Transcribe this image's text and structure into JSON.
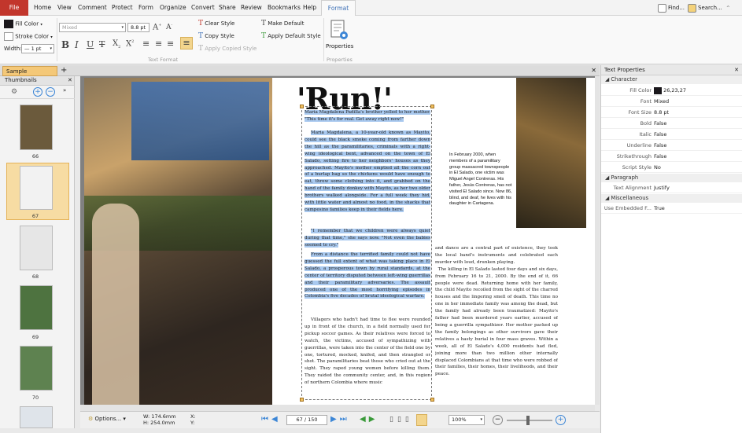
{
  "menu": {
    "file": "File",
    "items": [
      "Home",
      "View",
      "Comment",
      "Protect",
      "Form",
      "Organize",
      "Convert",
      "Share",
      "Review",
      "Bookmarks",
      "Help"
    ],
    "active": "Format",
    "find": "Find...",
    "search": "Search..."
  },
  "ribbon": {
    "fill_color": "Fill Color",
    "stroke_color": "Stroke Color",
    "width_label": "Width:",
    "width_value": "1 pt",
    "font_placeholder": "Mixed",
    "font_size": "8.8 pt",
    "clear_style": "Clear Style",
    "copy_style": "Copy Style",
    "apply_copied_style": "Apply Copied Style",
    "make_default": "Make Default",
    "apply_default_style": "Apply Default Style",
    "properties": "Properties",
    "group_text_format": "Text Format",
    "group_properties": "Properties"
  },
  "document_tab": "Sample Document *",
  "thumbnails": {
    "title": "Thumbnails",
    "pages": [
      "66",
      "67",
      "68",
      "69",
      "70"
    ]
  },
  "article": {
    "headline": "'Run!'",
    "col1_p1": "Maria Magdalena Padilla's brother yelled to her mother. \"This time it's for real. Get away right now!\"",
    "col1_p2": "Maria Magdalena, a 10-year-old known as Mayito, could see the black smoke coming from farther down the hill as the paramilitaries, criminals with a right-wing ideological bent, advanced on the town of El Salado, setting fire to her neighbors' houses as they approached. Mayito's mother emptied all the corn out of a burlap bag so the chickens would have enough to eat, threw some clothing into it, and grabbed on the hand of the family donkey with Mayito, as her two older brothers walked alongside. For a full week they hid, with little water and almost no food, in the shacks that campesino families keep in their fields here.",
    "col1_p3": "\"I remember that we children were always quiet during that time,\" she says now. \"Not even the babies seemed to cry.\"",
    "col1_p4": "From a distance the terrified family could not have guessed the full extent of what was taking place in El Salado, a prosperous town by rural standards, at the center of territory disputed between left-wing guerrillas and their paramilitary adversaries. The assault produced one of the most horrifying episodes in Colombia's five decades of brutal ideological warfare.",
    "col1_p5": "Villagers who hadn't had time to flee were rounded up in front of the church, in a field normally used for pickup soccer games. As their relatives were forced to watch, the victims, accused of sympathizing with guerrillas, were taken into the center of the field one by one, tortured, mocked, knifed, and then strangled or shot. The paramilitaries beat those who cried out at the sight. They raped young women before killing them. They raided the community center, and, in this region of northern Colombia where music",
    "caption": "In February 2000, when members of a paramilitary group massacred townspeople in El Salado, one victim was Miguel Angel Contreras. His father, Jesús Contreras, has not visited El Salado since. Now 86, blind, and deaf, he lives with his daughter in Cartagena.",
    "col2": "and dance are a central part of existence, they took the local band's instruments and celebrated each murder with loud, drunken playing.\n  The killing in El Salado lasted four days and six days, from February 16 to 21, 2000. By the end of it, 66 people were dead. Returning home with her family, the child Mayito recoiled from the sight of the charred houses and the lingering smell of death. This time no one in her immediate family was among the dead, but the family had already been traumatized: Mayito's father had been murdered years earlier, accused of being a guerrilla sympathizer. Her mother packed up the family belongings as other survivors gave their relatives a hasty burial in four mass graves. Within a week, all of El Salado's 4,000 residents had fled, joining more than two million other internally displaced Colombians at that time who were robbed of their families, their homes, their livelihoods, and their peace."
  },
  "bottom": {
    "options": "Options...",
    "w": "W: 174.6mm",
    "h": "H: 254.0mm",
    "x": "X:",
    "y": "Y:",
    "page": "67 / 150",
    "zoom": "100%"
  },
  "properties_panel": {
    "title": "Text Properties",
    "sections": {
      "character": "Character",
      "paragraph": "Paragraph",
      "misc": "Miscellaneous"
    },
    "rows": [
      {
        "k": "Fill Color",
        "v": "26,23,27"
      },
      {
        "k": "Font",
        "v": "Mixed"
      },
      {
        "k": "Font Size",
        "v": "8.8 pt"
      },
      {
        "k": "Bold",
        "v": "False"
      },
      {
        "k": "Italic",
        "v": "False"
      },
      {
        "k": "Underline",
        "v": "False"
      },
      {
        "k": "Strikethrough",
        "v": "False"
      },
      {
        "k": "Script Style",
        "v": "No"
      },
      {
        "k": "Text Alignment",
        "v": "Justify"
      },
      {
        "k": "Use Embedded F...",
        "v": "True"
      }
    ]
  },
  "colors": {
    "accent": "#c2362c",
    "tab": "#f4c878",
    "highlight": "#a9c9ef"
  }
}
